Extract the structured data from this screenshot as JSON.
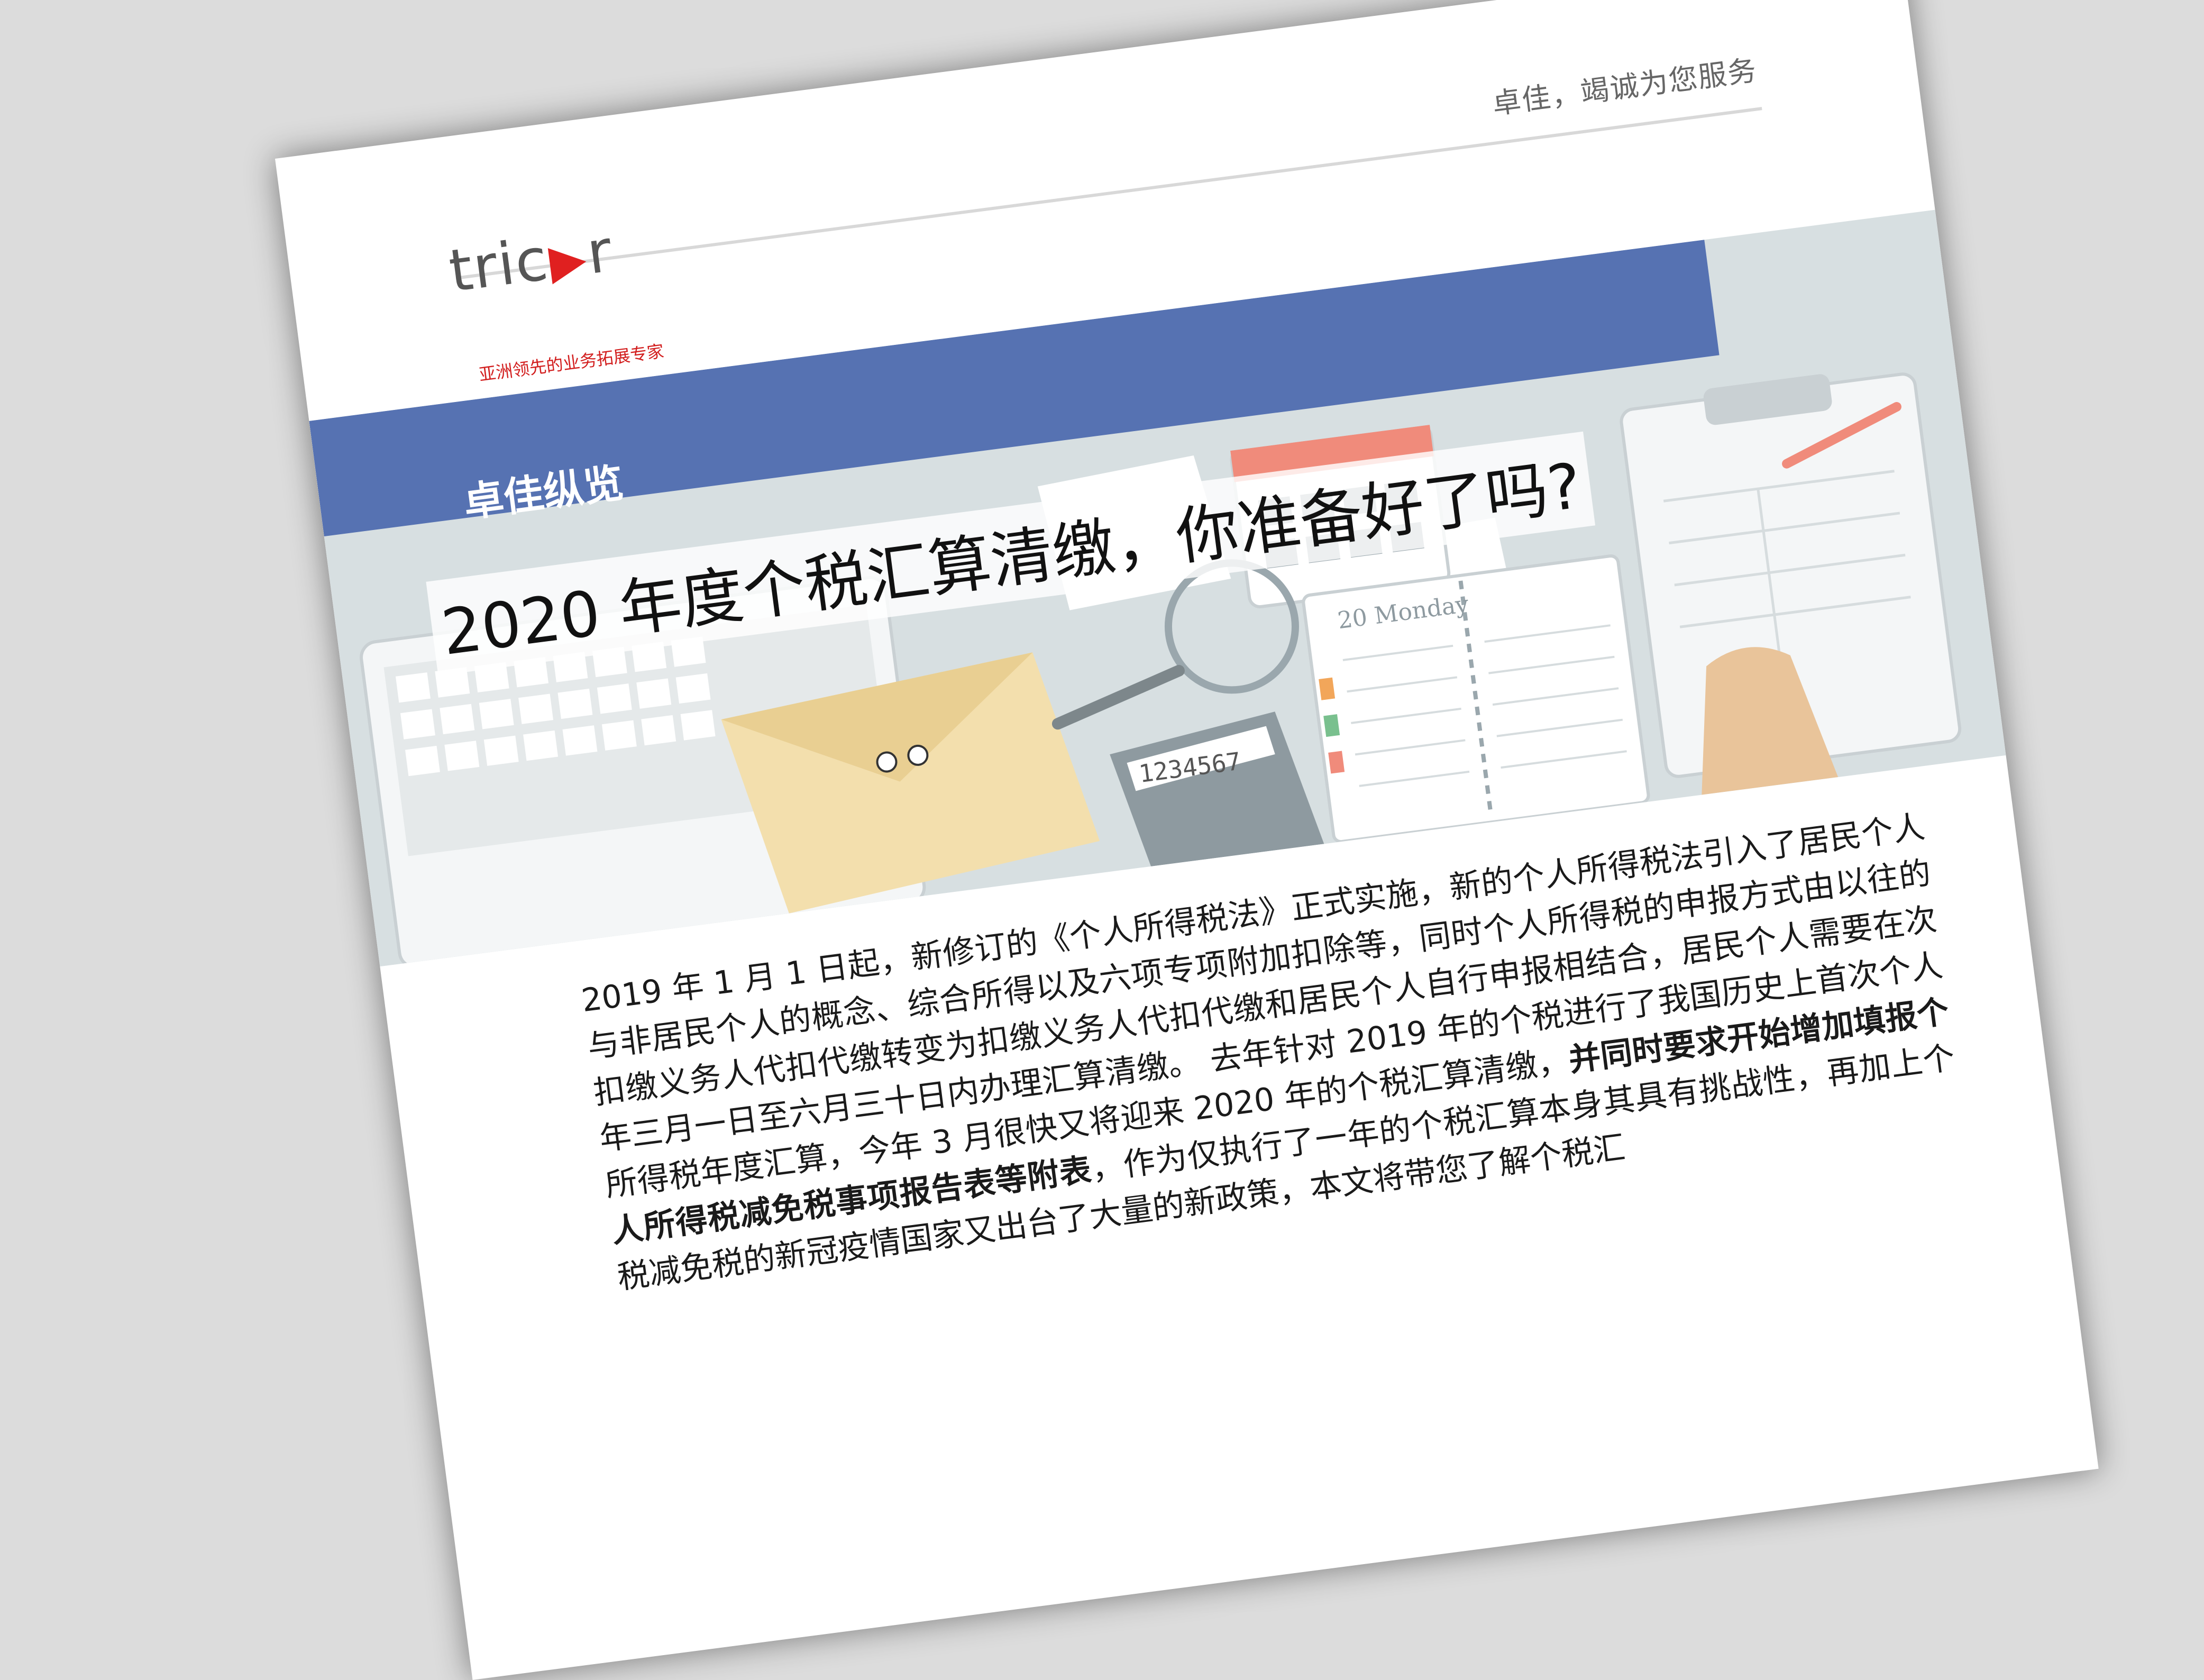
{
  "header": {
    "tagline": "卓佳，竭诚为您服务",
    "logo_left": "tric",
    "logo_right": "r",
    "slogan": "亚洲领先的业务拓展专家"
  },
  "banner": {
    "section_label": "卓佳纵览",
    "headline": "2020 年度个税汇算清缴，你准备好了吗?",
    "planner_label": "20 Monday",
    "calculator_display": "1234567"
  },
  "article": {
    "p1": "2019 年 1 月 1 日起，新修订的《个人所得税法》正式实施，新的个人所得税法引入了居民个人与非居民个人的概念、综合所得以及六项专项附加扣除等，同时个人所得税的申报方式由以往的扣缴义务人代扣代缴转变为扣缴义务人代扣代缴和居民个人自行申报相结合，居民个人需要在次年三月一日至六月三十日内办理汇算清缴。 去年针对 2019 年的个税进行了我国历史上首次个人所得税年度汇算，今年 3 月很快又将迎来 2020 年的个税汇算清缴，",
    "bold1": "并同时要求开始增加填报个人所得税减免税事项报告表等附表",
    "p2": "，作为仅执行了一年的个税汇算本身其具有挑战性，再加上个税减免税",
    "p3": "的新冠疫情国家又出台了大量的新政策，本文将带您了解个税汇"
  },
  "colors": {
    "brand_red": "#d21d1d",
    "banner_blue": "#5672b2",
    "banner_bg": "#d7dfe1"
  }
}
